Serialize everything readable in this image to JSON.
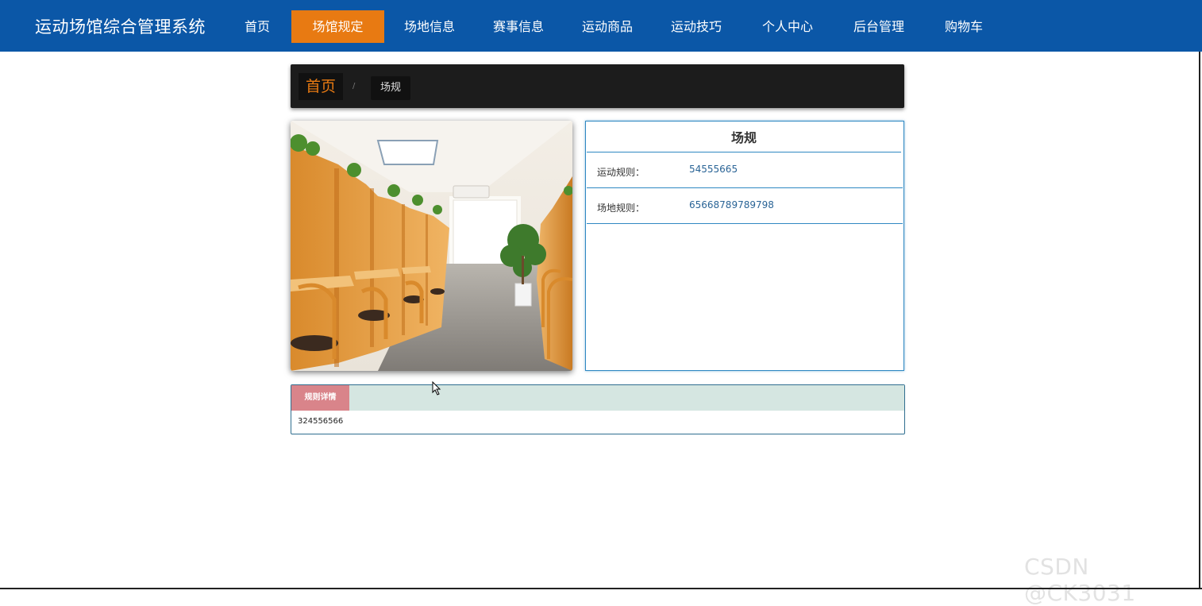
{
  "header": {
    "brand": "运动场馆综合管理系统",
    "nav": [
      {
        "label": "首页",
        "active": false
      },
      {
        "label": "场馆规定",
        "active": true
      },
      {
        "label": "场地信息",
        "active": false
      },
      {
        "label": "赛事信息",
        "active": false
      },
      {
        "label": "运动商品",
        "active": false
      },
      {
        "label": "运动技巧",
        "active": false
      },
      {
        "label": "个人中心",
        "active": false
      },
      {
        "label": "后台管理",
        "active": false
      },
      {
        "label": "购物车",
        "active": false
      }
    ],
    "bg_color": "#0b57a7",
    "active_color": "#e87a12"
  },
  "breadcrumb": {
    "home": "首页",
    "separator": "/",
    "current": "场规"
  },
  "image": {
    "subject": "study-room-cubicles-photo"
  },
  "info": {
    "title": "场规",
    "rows": [
      {
        "label": "运动规则：",
        "value": "54555665"
      },
      {
        "label": "场地规则：",
        "value": "65668789789798"
      }
    ]
  },
  "detail": {
    "tab": "规则详情",
    "content": "324556566"
  },
  "watermark": "CSDN @CK3031"
}
